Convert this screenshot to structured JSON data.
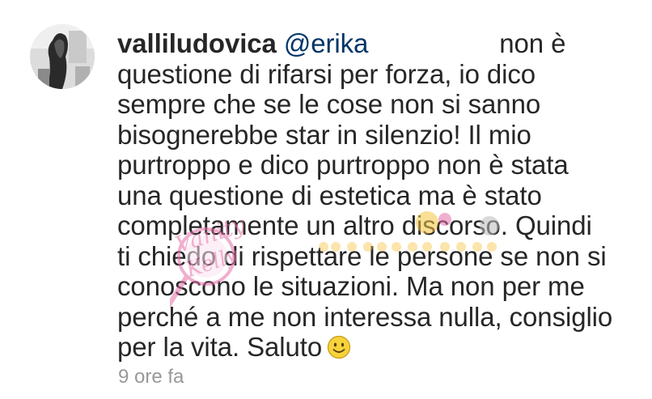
{
  "comment": {
    "username": "valliludovica",
    "mention": "@erika",
    "lines": [
      "non è",
      "questione di rifarsi per forza, io dico",
      "sempre che se le cose non si sanno",
      "bisognerebbe star in silenzio! Il mio",
      "purtroppo e dico purtroppo non è stata",
      "una questione di estetica ma è stato",
      "completamente un altro discorso. Quindi",
      "ti chiedo di rispettare le persone se non si",
      "conoscono le situazioni. Ma non per me",
      "perché a me non interessa nulla, consiglio",
      "per la vita. Saluto"
    ],
    "emoji": "slightly-smiling-face-icon",
    "timestamp": "9 ore fa"
  },
  "watermark": {
    "brand": "Vanity Kelly",
    "tagline": "gossip e trash",
    "colors": {
      "pink": "#e56fa8",
      "yellow": "#f5c542"
    }
  },
  "colors": {
    "text": "#262626",
    "mention": "#003569",
    "timestamp": "#999999",
    "background": "#ffffff"
  }
}
